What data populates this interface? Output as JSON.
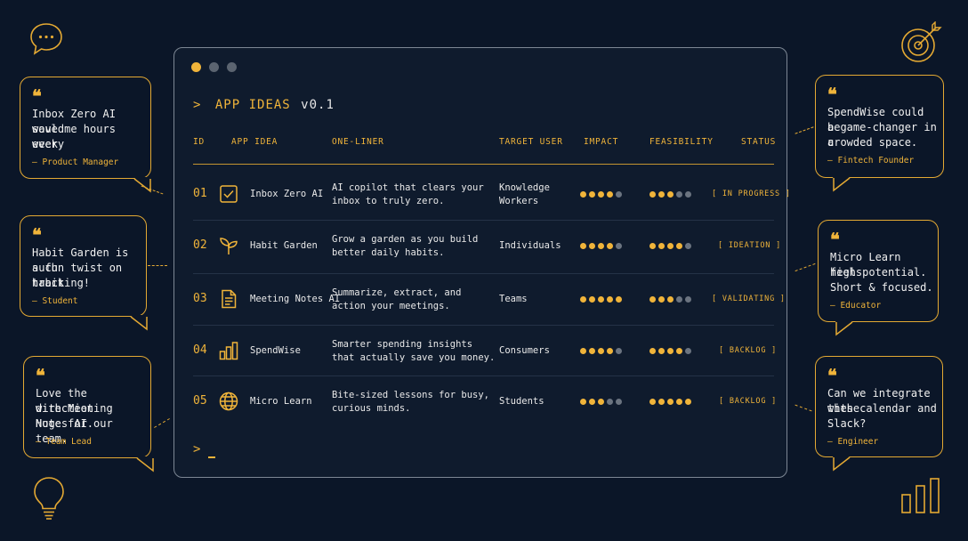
{
  "terminal": {
    "prompt": ">",
    "title": "APP IDEAS",
    "version": "v0.1",
    "window_dots": [
      "#f0b43a",
      "#5b6470",
      "#5b6470"
    ],
    "bottom_prompt": ">"
  },
  "headers": {
    "id": "ID",
    "app_idea": "APP IDEA",
    "one_liner": "ONE-LINER",
    "target_user": "TARGET USER",
    "impact": "IMPACT",
    "feasibility": "FEASIBILITY",
    "status": "STATUS"
  },
  "rows": [
    {
      "id": "01",
      "icon": "checkbox-icon",
      "name": "Inbox Zero AI",
      "line1": "AI copilot that clears your",
      "line2": "inbox to truly zero.",
      "user1": "Knowledge",
      "user2": "Workers",
      "impact": 4,
      "feasibility": 3,
      "status": "[ IN PROGRESS ]"
    },
    {
      "id": "02",
      "icon": "sprout-icon",
      "name": "Habit Garden",
      "line1": "Grow a garden as you build",
      "line2": "better daily habits.",
      "user1": "Individuals",
      "user2": "",
      "impact": 4,
      "feasibility": 4,
      "status": "[ IDEATION ]"
    },
    {
      "id": "03",
      "icon": "document-icon",
      "name": "Meeting Notes AI",
      "line1": "Summarize, extract, and",
      "line2": "action your meetings.",
      "user1": "Teams",
      "user2": "",
      "impact": 5,
      "feasibility": 3,
      "status": "[ VALIDATING ]"
    },
    {
      "id": "04",
      "icon": "bar-chart-icon",
      "name": "SpendWise",
      "line1": "Smarter spending insights",
      "line2": "that actually save you money.",
      "user1": "Consumers",
      "user2": "",
      "impact": 4,
      "feasibility": 4,
      "status": "[ BACKLOG ]"
    },
    {
      "id": "05",
      "icon": "globe-icon",
      "name": "Micro Learn",
      "line1": "Bite-sized lessons for busy,",
      "line2": "curious minds.",
      "user1": "Students",
      "user2": "",
      "impact": 3,
      "feasibility": 5,
      "status": "[ BACKLOG ]"
    }
  ],
  "rating_max": 5,
  "bubbles": [
    {
      "quote_mark": "❝",
      "lines": [
        "Inbox Zero AI would",
        "save me hours every",
        "week."
      ],
      "author": "— Product Manager"
    },
    {
      "quote_mark": "❝",
      "lines": [
        "Habit Garden is such",
        "a fun twist on habit",
        "tracking!"
      ],
      "author": "— Student"
    },
    {
      "quote_mark": "❝",
      "lines": [
        "Love the direction",
        "with Meeting Notes AI.",
        "Huge for our team."
      ],
      "author": "— Team Lead"
    },
    {
      "quote_mark": "❝",
      "lines": [
        "SpendWise could be",
        "a game-changer in a",
        "crowded space."
      ],
      "author": "— Fintech Founder"
    },
    {
      "quote_mark": "❝",
      "lines": [
        "Micro Learn feels",
        "high potential.",
        "Short & focused."
      ],
      "author": "— Educator"
    },
    {
      "quote_mark": "❝",
      "lines": [
        "Can we integrate these",
        "with calendar and",
        "Slack?"
      ],
      "author": "— Engineer"
    }
  ],
  "decorations": [
    "chat-bubble-icon",
    "target-icon",
    "lightbulb-icon",
    "bar-chart-icon"
  ],
  "colors": {
    "accent": "#f0b43a",
    "background": "#0b1628",
    "panel": "#0f1b2d",
    "muted_dot": "#6b7480"
  }
}
